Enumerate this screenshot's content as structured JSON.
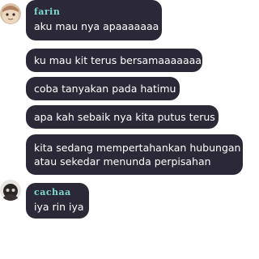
{
  "messages": [
    {
      "sender": "farin",
      "sender_color": "#7ed8d0",
      "lines": [
        "aku mau nya apaaaaaaa"
      ]
    },
    {
      "lines": [
        "ku mau kit terus bersamaaaaaaa"
      ]
    },
    {
      "lines": [
        "coba tanyakan pada hatimu"
      ]
    },
    {
      "lines": [
        "apa kah sebaik nya kita putus terus"
      ]
    },
    {
      "lines": [
        "kita sedang mempertahankan hubungan",
        "atau sekedar menunda perpisahan"
      ]
    },
    {
      "sender": "cachaa",
      "sender_color": "#7ed8d0",
      "lines": [
        "iya rin iya"
      ]
    }
  ],
  "colors": {
    "bubble_bg": "#2b2838",
    "message_text": "#ffffff",
    "name_text": "#7ed8d0"
  },
  "icons": {
    "avatar_farin": "avatar-farin-icon",
    "avatar_cachaa": "avatar-cachaa-icon"
  }
}
